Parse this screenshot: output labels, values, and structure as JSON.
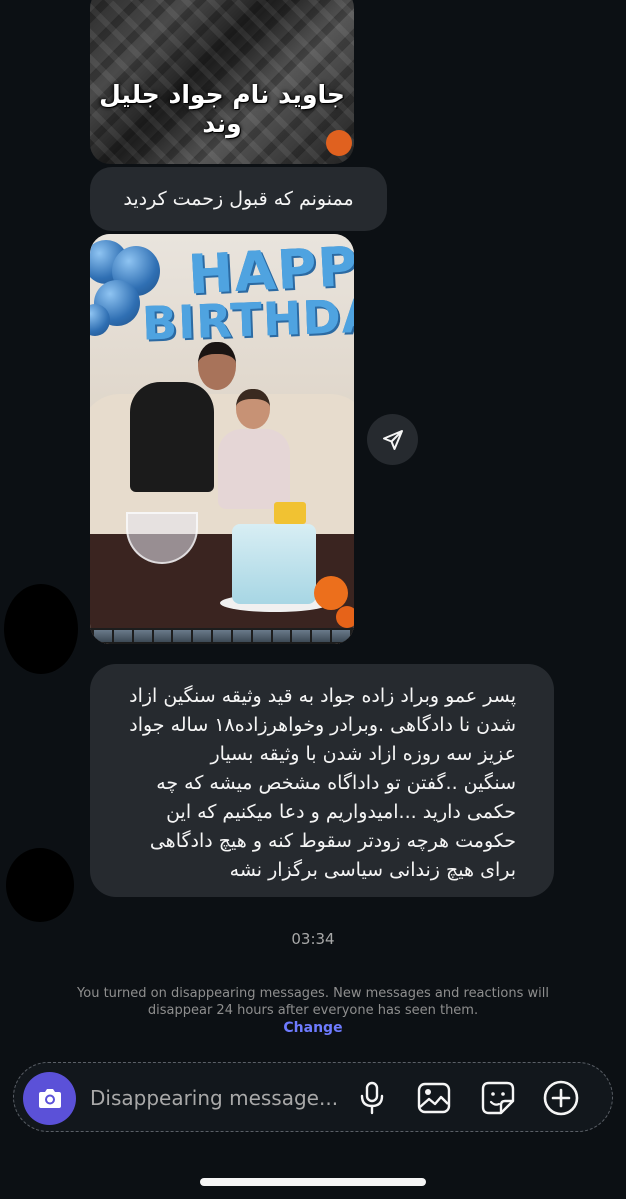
{
  "thread": {
    "image_caption": "جاوید نام جواد جلیل وند",
    "message_thanks": "ممنونم که قبول زحمت کردید",
    "photo_banner": {
      "line1": "HAPPY",
      "line2": "BIRTHDAY"
    },
    "message_long_lines": [
      "پسر عمو وبراد زاده جواد به قید وثیقه سنگین ازاد",
      "شدن نا دادگاهی .وبرادر وخواهرزاده۱۸ ساله جواد",
      "عزیز سه روزه ازاد شدن با وثیقه بسیار",
      "سنگین ..گفتن تو داداگاه مشخص میشه که چه",
      "حکمی دارید ...امیدواریم و دعا میکنیم که این",
      "حکومت هرچه زودتر سقوط کنه و هیچ دادگاهی",
      "برای هیچ زندانی سیاسی برگزار نشه"
    ],
    "timestamp": "03:34"
  },
  "system_notice": {
    "text": "You turned on disappearing messages. New messages and reactions will disappear 24 hours after everyone has seen them.",
    "link": "Change"
  },
  "composer": {
    "placeholder": "Disappearing message...",
    "icons": [
      "camera-icon",
      "microphone-icon",
      "gallery-icon",
      "sticker-icon",
      "plus-icon"
    ]
  },
  "colors": {
    "background": "#0c1014",
    "bubble": "#262a2f",
    "accent": "#5b51d8",
    "link": "#6e7bff"
  }
}
